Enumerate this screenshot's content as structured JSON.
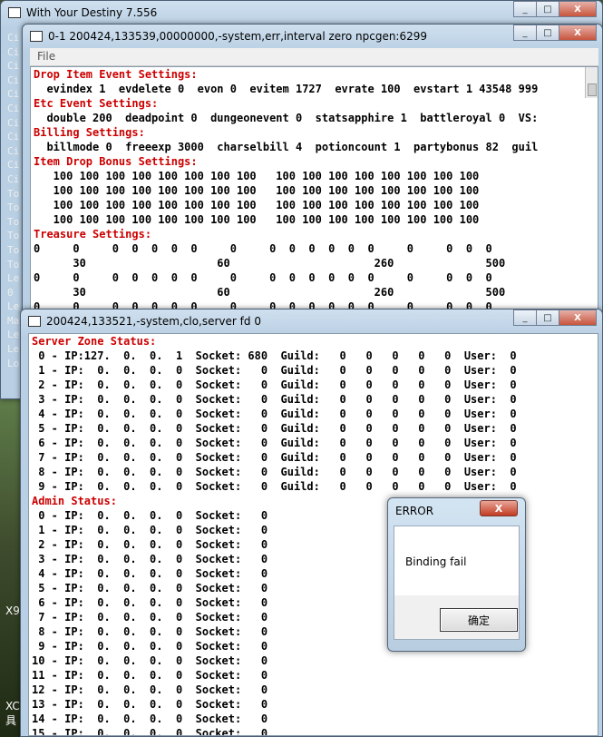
{
  "main_window": {
    "title": "With Your Destiny 7.556",
    "min": "_",
    "max": "□",
    "close": "X"
  },
  "side_labels": [
    "Ci",
    "Ci",
    "Ci",
    "Ci",
    "Ci",
    "Ci",
    "Ci",
    "Ci",
    "Ci",
    "Ci",
    "Ci",
    "To",
    "To",
    "To",
    "To",
    "To",
    "To",
    "Le",
    "0",
    "Le",
    "Ma",
    "Le",
    "Le",
    "Lo"
  ],
  "side_bottom_a": "X9",
  "side_bottom_b": [
    "XC",
    "具"
  ],
  "child1": {
    "title": "0-1 200424,133539,00000000,-system,err,interval zero npcgen:6299",
    "menu_file": "File",
    "lines": [
      {
        "t": "Drop Item Event Settings:",
        "h": true
      },
      {
        "t": "  evindex 1  evdelete 0  evon 0  evitem 1727  evrate 100  evstart 1 43548 999",
        "h": false
      },
      {
        "t": "Etc Event Settings:",
        "h": true
      },
      {
        "t": "  double 200  deadpoint 0  dungeonevent 0  statsapphire 1  battleroyal 0  VS:",
        "h": false
      },
      {
        "t": "Billing Settings:",
        "h": true
      },
      {
        "t": "  billmode 0  freeexp 3000  charselbill 4  potioncount 1  partybonus 82  guil",
        "h": false
      },
      {
        "t": "Item Drop Bonus Settings:",
        "h": true
      },
      {
        "t": "   100 100 100 100 100 100 100 100   100 100 100 100 100 100 100 100",
        "h": false
      },
      {
        "t": "   100 100 100 100 100 100 100 100   100 100 100 100 100 100 100 100",
        "h": false
      },
      {
        "t": "   100 100 100 100 100 100 100 100   100 100 100 100 100 100 100 100",
        "h": false
      },
      {
        "t": "   100 100 100 100 100 100 100 100   100 100 100 100 100 100 100 100",
        "h": false
      },
      {
        "t": "Treasure Settings:",
        "h": true
      },
      {
        "t": "0     0     0  0  0  0  0     0     0  0  0  0  0  0     0     0  0  0",
        "h": false
      },
      {
        "t": "      30                    60                      260              500",
        "h": false
      },
      {
        "t": "0     0     0  0  0  0  0     0     0  0  0  0  0  0     0     0  0  0",
        "h": false
      },
      {
        "t": "      30                    60                      260              500",
        "h": false
      },
      {
        "t": "0     0     0  0  0  0  0     0     0  0  0  0  0  0     0     0  0  0",
        "h": false
      }
    ]
  },
  "child2": {
    "title": "200424,133521,-system,clo,server fd 0",
    "lines": [
      {
        "t": "Server Zone Status:",
        "h": true
      },
      {
        "t": " 0 - IP:127.  0.  0.  1  Socket: 680  Guild:   0   0   0   0   0  User:  0",
        "h": false
      },
      {
        "t": " 1 - IP:  0.  0.  0.  0  Socket:   0  Guild:   0   0   0   0   0  User:  0",
        "h": false
      },
      {
        "t": " 2 - IP:  0.  0.  0.  0  Socket:   0  Guild:   0   0   0   0   0  User:  0",
        "h": false
      },
      {
        "t": " 3 - IP:  0.  0.  0.  0  Socket:   0  Guild:   0   0   0   0   0  User:  0",
        "h": false
      },
      {
        "t": " 4 - IP:  0.  0.  0.  0  Socket:   0  Guild:   0   0   0   0   0  User:  0",
        "h": false
      },
      {
        "t": " 5 - IP:  0.  0.  0.  0  Socket:   0  Guild:   0   0   0   0   0  User:  0",
        "h": false
      },
      {
        "t": " 6 - IP:  0.  0.  0.  0  Socket:   0  Guild:   0   0   0   0   0  User:  0",
        "h": false
      },
      {
        "t": " 7 - IP:  0.  0.  0.  0  Socket:   0  Guild:   0   0   0   0   0  User:  0",
        "h": false
      },
      {
        "t": " 8 - IP:  0.  0.  0.  0  Socket:   0  Guild:   0   0   0   0   0  User:  0",
        "h": false
      },
      {
        "t": " 9 - IP:  0.  0.  0.  0  Socket:   0  Guild:   0   0   0   0   0  User:  0",
        "h": false
      },
      {
        "t": "Admin Status:",
        "h": true
      },
      {
        "t": " 0 - IP:  0.  0.  0.  0  Socket:   0",
        "h": false
      },
      {
        "t": " 1 - IP:  0.  0.  0.  0  Socket:   0",
        "h": false
      },
      {
        "t": " 2 - IP:  0.  0.  0.  0  Socket:   0",
        "h": false
      },
      {
        "t": " 3 - IP:  0.  0.  0.  0  Socket:   0",
        "h": false
      },
      {
        "t": " 4 - IP:  0.  0.  0.  0  Socket:   0",
        "h": false
      },
      {
        "t": " 5 - IP:  0.  0.  0.  0  Socket:   0",
        "h": false
      },
      {
        "t": " 6 - IP:  0.  0.  0.  0  Socket:   0",
        "h": false
      },
      {
        "t": " 7 - IP:  0.  0.  0.  0  Socket:   0",
        "h": false
      },
      {
        "t": " 8 - IP:  0.  0.  0.  0  Socket:   0",
        "h": false
      },
      {
        "t": " 9 - IP:  0.  0.  0.  0  Socket:   0",
        "h": false
      },
      {
        "t": "10 - IP:  0.  0.  0.  0  Socket:   0",
        "h": false
      },
      {
        "t": "11 - IP:  0.  0.  0.  0  Socket:   0",
        "h": false
      },
      {
        "t": "12 - IP:  0.  0.  0.  0  Socket:   0",
        "h": false
      },
      {
        "t": "13 - IP:  0.  0.  0.  0  Socket:   0",
        "h": false
      },
      {
        "t": "14 - IP:  0.  0.  0.  0  Socket:   0",
        "h": false
      },
      {
        "t": "15 - IP:  0.  0.  0.  0  Socket:   0",
        "h": false
      }
    ]
  },
  "error_dialog": {
    "title": "ERROR",
    "close": "X",
    "message": "Binding fail",
    "ok_label": "确定"
  }
}
